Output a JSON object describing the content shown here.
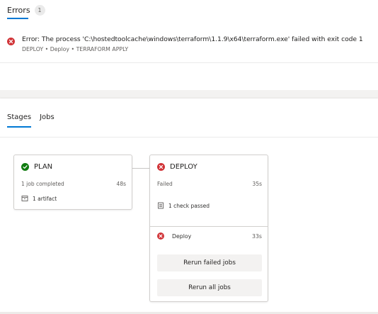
{
  "errors": {
    "tab_label": "Errors",
    "count": "1",
    "items": [
      {
        "message": "Error: The process 'C:\\hostedtoolcache\\windows\\terraform\\1.1.9\\x64\\terraform.exe' failed with exit code 1",
        "path": "DEPLOY • Deploy • TERRAFORM APPLY",
        "icon": "error-circle-icon"
      }
    ]
  },
  "tabs": [
    {
      "label": "Stages",
      "active": true
    },
    {
      "label": "Jobs",
      "active": false
    }
  ],
  "stages": {
    "plan": {
      "name": "PLAN",
      "status": "succeeded",
      "summary": "1 job completed",
      "duration": "48s",
      "artifact": "1 artifact"
    },
    "deploy": {
      "name": "DEPLOY",
      "status": "failed",
      "summary": "Failed",
      "duration": "35s",
      "checks": "1 check passed",
      "job": {
        "name": "Deploy",
        "duration": "33s"
      },
      "rerun_failed_label": "Rerun failed jobs",
      "rerun_all_label": "Rerun all jobs"
    }
  },
  "colors": {
    "accent": "#0078d4",
    "error": "#d13438",
    "success": "#107c10"
  }
}
